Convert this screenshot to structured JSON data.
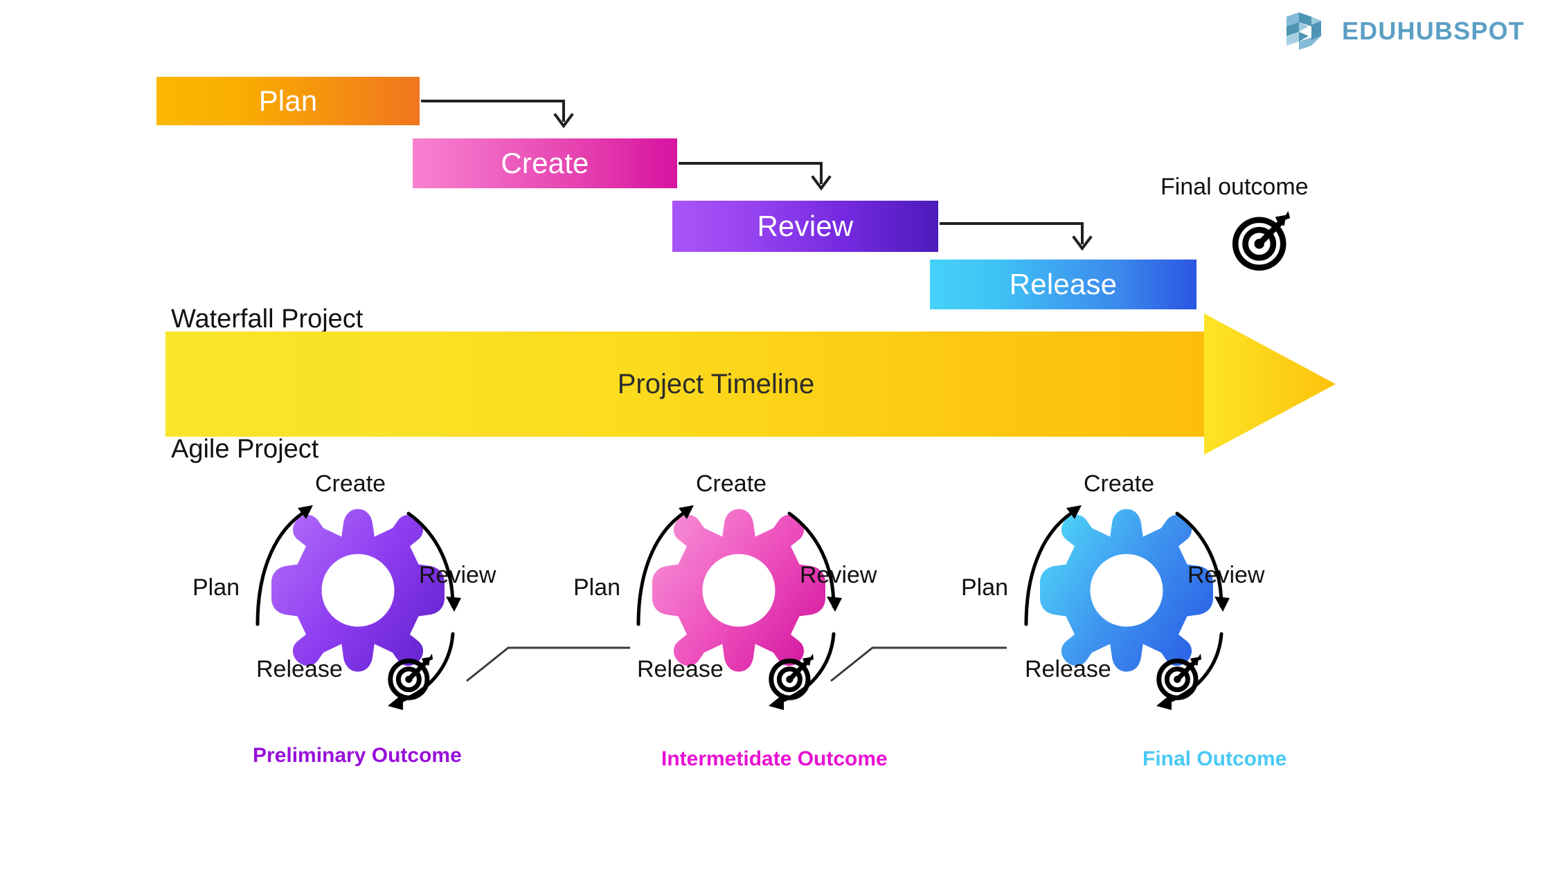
{
  "brand": {
    "name": "EDUHUBSPOT",
    "logo_icon": "hexagon-logo-icon",
    "color": "#5C9FC4"
  },
  "waterfall": {
    "section_title": "Waterfall Project",
    "phases": [
      {
        "label": "Plan",
        "gradient_from": "#FBB800",
        "gradient_to": "#F0761E"
      },
      {
        "label": "Create",
        "gradient_from": "#F881D0",
        "gradient_to": "#D713A0"
      },
      {
        "label": "Review",
        "gradient_from": "#A855F7",
        "gradient_to": "#4C1BBB"
      },
      {
        "label": "Release",
        "gradient_from": "#46D2F8",
        "gradient_to": "#2B55E2"
      }
    ],
    "final_outcome_label": "Final outcome",
    "final_outcome_icon": "target-dart-icon"
  },
  "timeline": {
    "label": "Project Timeline",
    "gradient_from": "#F9E62B",
    "gradient_to": "#FDBE0A",
    "arrow_icon": "right-arrow-banner-icon"
  },
  "agile": {
    "section_title": "Agile Project",
    "cycles": [
      {
        "steps": {
          "plan": "Plan",
          "create": "Create",
          "review": "Review",
          "release": "Release"
        },
        "outcome_label": "Preliminary Outcome",
        "outcome_color": "#9810D9",
        "gear_from": "#A855F7",
        "gear_to": "#6D28D9",
        "outcome_icon": "target-dart-icon"
      },
      {
        "steps": {
          "plan": "Plan",
          "create": "Create",
          "review": "Review",
          "release": "Release"
        },
        "outcome_label": "Intermetidate Outcome",
        "outcome_color": "#E80FD2",
        "gear_from": "#F57FCF",
        "gear_to": "#DA1FA8",
        "outcome_icon": "target-dart-icon"
      },
      {
        "steps": {
          "plan": "Plan",
          "create": "Create",
          "review": "Review",
          "release": "Release"
        },
        "outcome_label": "Final Outcome",
        "outcome_color": "#49C9F5",
        "gear_from": "#48CDF7",
        "gear_to": "#2E63E8",
        "outcome_icon": "target-dart-icon"
      }
    ]
  }
}
